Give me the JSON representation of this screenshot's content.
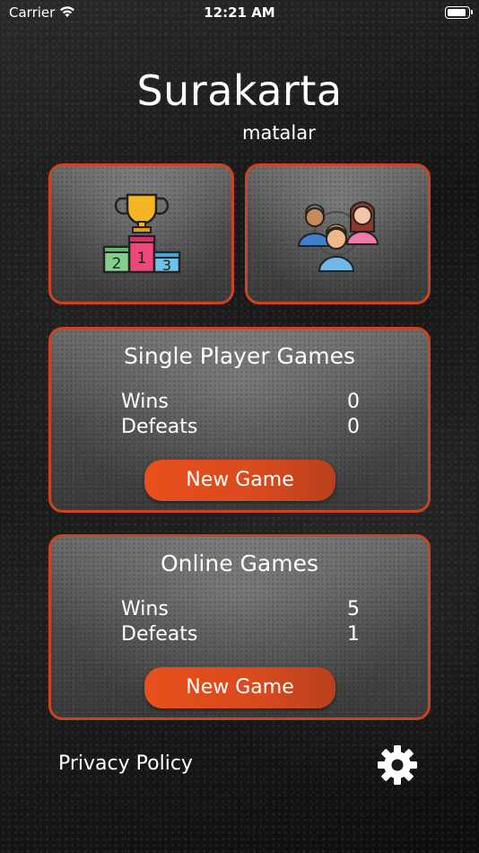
{
  "status_bar": {
    "carrier": "Carrier",
    "time": "12:21 AM",
    "battery_level": 0.85
  },
  "header": {
    "title": "Surakarta",
    "subtitle": "matalar"
  },
  "tiles": {
    "leaderboard_icon": "trophy-podium-icon",
    "multiplayer_icon": "group-players-icon"
  },
  "single_player": {
    "title": "Single Player Games",
    "wins_label": "Wins",
    "wins": "0",
    "defeats_label": "Defeats",
    "defeats": "0",
    "button": "New Game"
  },
  "online": {
    "title": "Online Games",
    "wins_label": "Wins",
    "wins": "5",
    "defeats_label": "Defeats",
    "defeats": "1",
    "button": "New Game"
  },
  "footer": {
    "privacy": "Privacy Policy",
    "settings_icon": "gear-icon"
  },
  "colors": {
    "accent": "#c94420",
    "button": "#e8501c",
    "text": "#ffffff"
  }
}
